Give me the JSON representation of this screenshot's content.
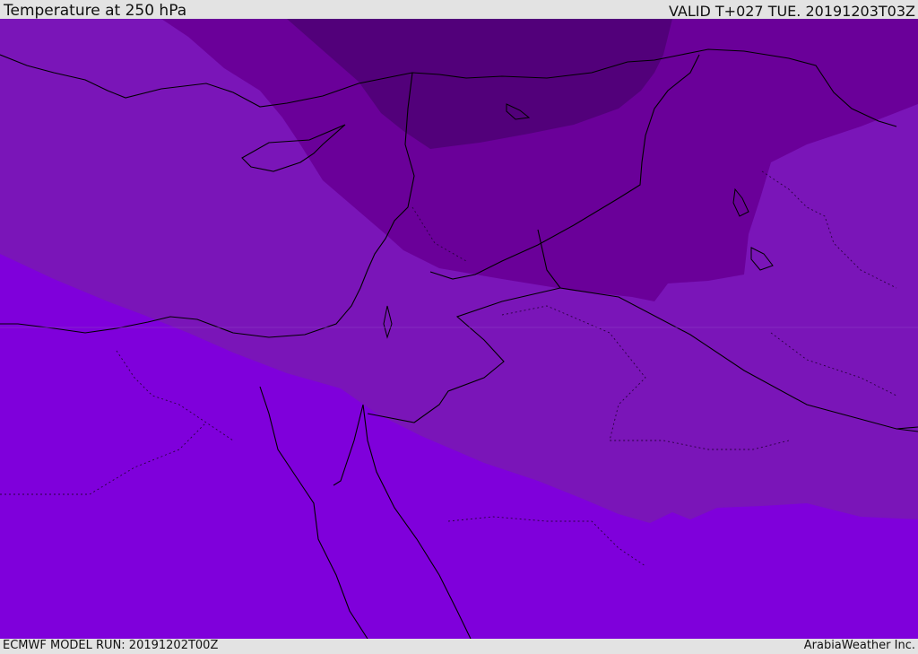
{
  "header": {
    "title": "Temperature at 250 hPa",
    "valid": "VALID T+027 TUE. 20191203T03Z"
  },
  "footer": {
    "model_run": "ECMWF MODEL RUN: 20191202T00Z",
    "credit": "ArabiaWeather Inc."
  },
  "colors": {
    "band_warmest": "#7f00db",
    "band_mid": "#7a15b8",
    "band_cool": "#6a0099",
    "band_coldest": "#52007a",
    "header_background": "#e3e3e3",
    "coastline": "#000000"
  }
}
